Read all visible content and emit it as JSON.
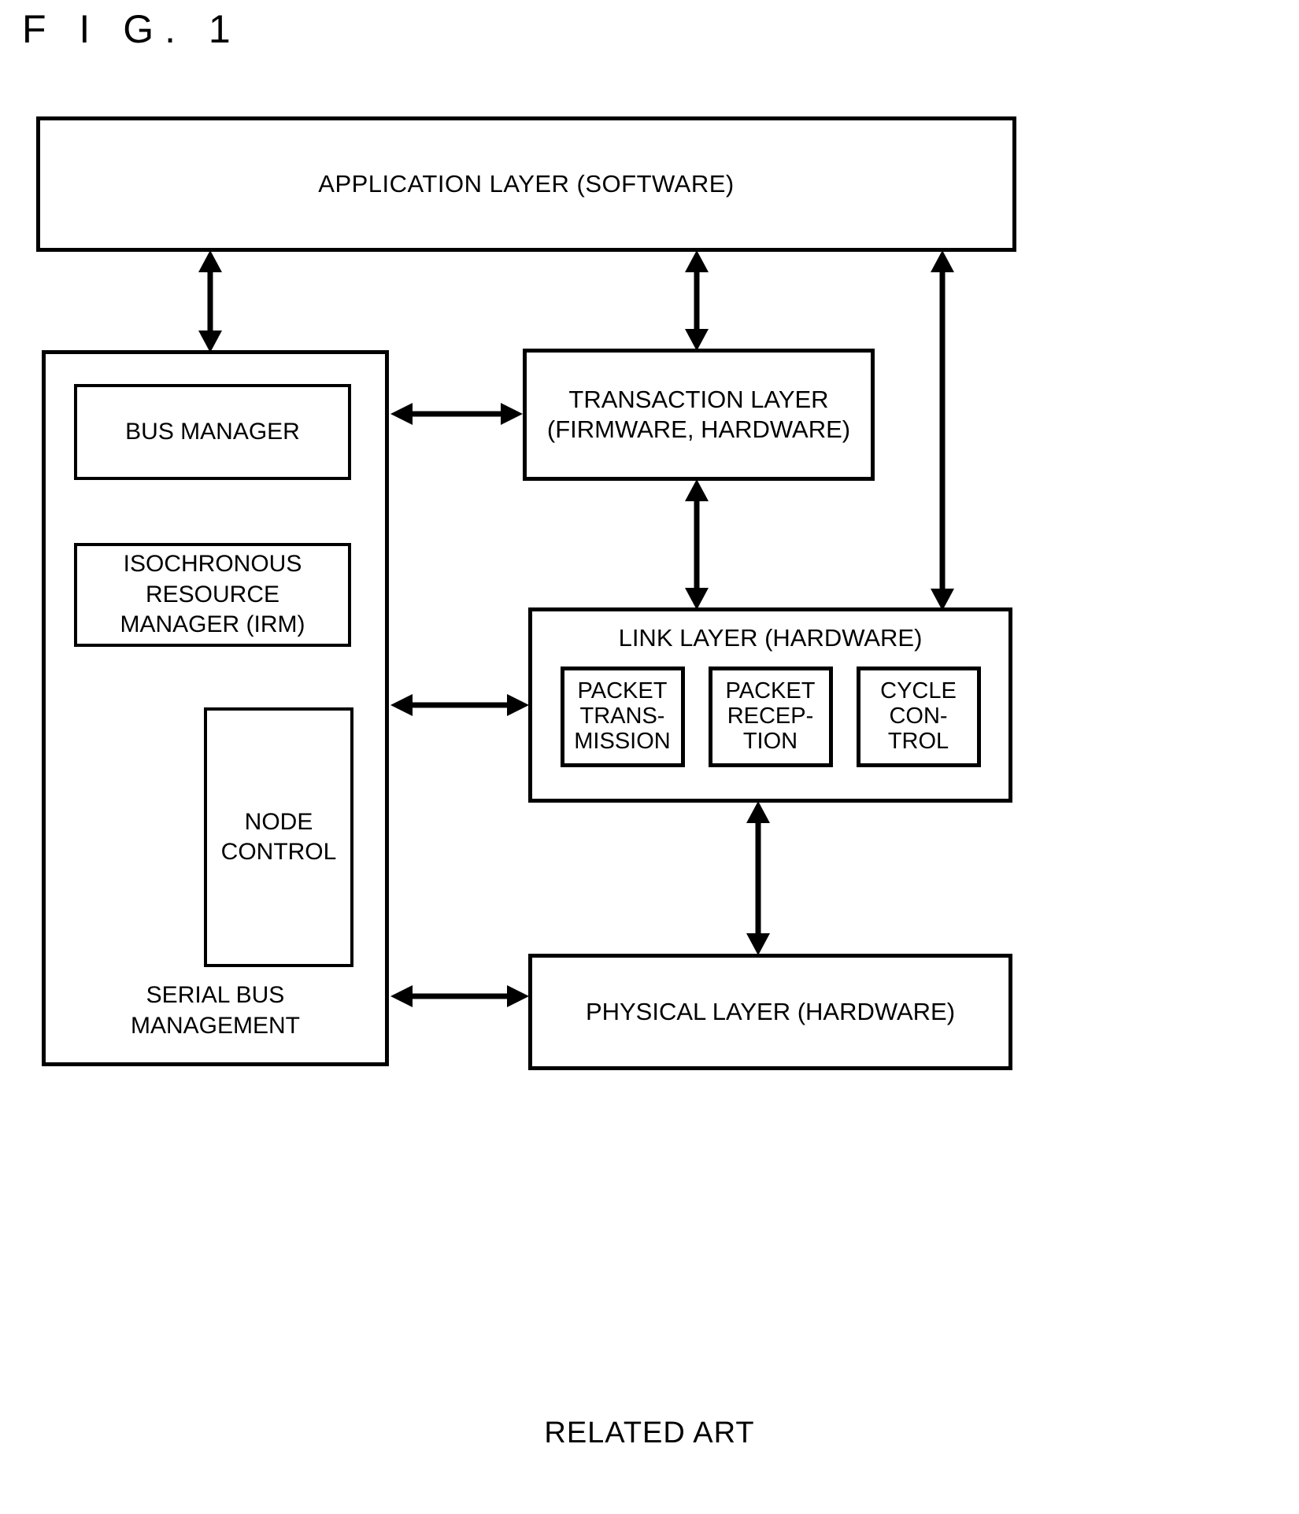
{
  "figure": {
    "title": "F I G.  1",
    "caption": "RELATED ART"
  },
  "blocks": {
    "application_layer": "APPLICATION LAYER (SOFTWARE)",
    "serial_bus_management": "SERIAL BUS\nMANAGEMENT",
    "bus_manager": "BUS MANAGER",
    "isochronous_resource_manager": "ISOCHRONOUS\nRESOURCE\nMANAGER (IRM)",
    "node_control": "NODE\nCONTROL",
    "transaction_layer": "TRANSACTION LAYER\n(FIRMWARE, HARDWARE)",
    "link_layer": "LINK LAYER (HARDWARE)",
    "packet_transmission": "PACKET\nTRANS-\nMISSION",
    "packet_reception": "PACKET\nRECEP-\nTION",
    "cycle_control": "CYCLE\nCON-\nTROL",
    "physical_layer": "PHYSICAL LAYER (HARDWARE)"
  },
  "connections": [
    {
      "name": "application-to-serial-bus-management",
      "type": "double-vertical"
    },
    {
      "name": "application-to-transaction-layer",
      "type": "double-vertical"
    },
    {
      "name": "application-to-link-layer",
      "type": "double-vertical"
    },
    {
      "name": "serial-bus-management-to-transaction-layer",
      "type": "double-horizontal"
    },
    {
      "name": "serial-bus-management-to-link-layer",
      "type": "double-horizontal"
    },
    {
      "name": "serial-bus-management-to-physical-layer",
      "type": "double-horizontal"
    },
    {
      "name": "transaction-layer-to-link-layer",
      "type": "double-vertical"
    },
    {
      "name": "link-layer-to-physical-layer",
      "type": "double-vertical"
    }
  ],
  "colors": {
    "ink": "#000000",
    "paper": "#ffffff"
  }
}
